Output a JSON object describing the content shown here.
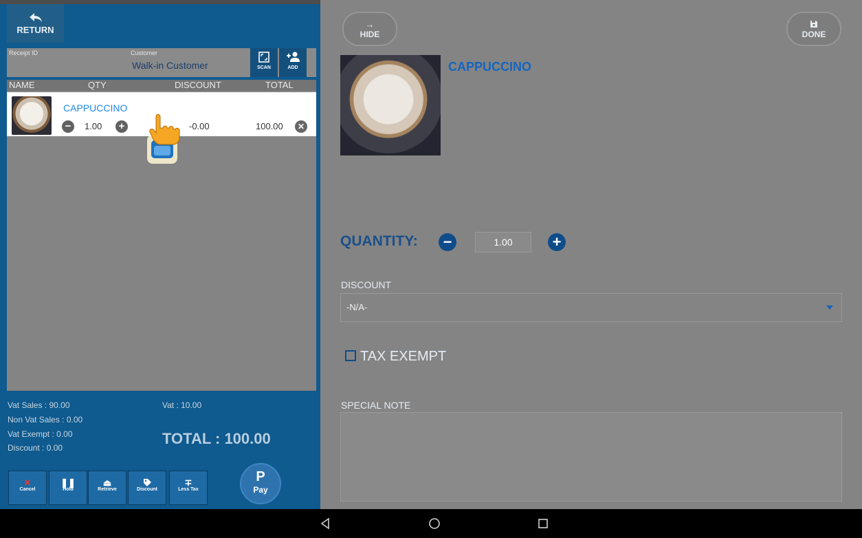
{
  "left": {
    "return_label": "RETURN",
    "receipt_label": "Receipt ID",
    "customer_label": "Customer",
    "customer_name": "Walk-in Customer",
    "scan_label": "SCAN",
    "add_label": "ADD",
    "columns": [
      "NAME",
      "QTY",
      "DISCOUNT",
      "TOTAL"
    ],
    "item": {
      "name": "CAPPUCCINO",
      "qty": "1.00",
      "discount": "-0.00",
      "total": "100.00"
    },
    "summary": {
      "vat_sales": "Vat Sales :     90.00",
      "non_vat_sales": "Non Vat Sales : 0.00",
      "vat_exempt": "Vat Exempt :   0.00",
      "discount": "Discount :     0.00",
      "vat": "Vat :          10.00",
      "total": "TOTAL : 100.00"
    },
    "actions": {
      "cancel": "Cancel",
      "hold": "Hold",
      "retrieve": "Retrieve",
      "discount": "Discount",
      "less_tax": "Less Tax",
      "pay_symbol": "P",
      "pay": "Pay"
    }
  },
  "right": {
    "hide_label": "HIDE",
    "done_label": "DONE",
    "product_title": "CAPPUCCINO",
    "quantity_label": "QUANTITY:",
    "quantity_value": "1.00",
    "discount_label": "DISCOUNT",
    "discount_value": "-N/A-",
    "tax_exempt_label": "TAX EXEMPT",
    "special_note_label": "SPECIAL NOTE"
  },
  "icons": {
    "return": "arrow-back-icon",
    "scan": "scan-frame-icon",
    "add": "add-person-icon",
    "hide": "arrow-right-icon",
    "done": "save-disk-icon"
  },
  "colors": {
    "left_panel": "#0f5a8e",
    "accent_blue": "#1e88e5",
    "cancel_red": "#e53935"
  }
}
